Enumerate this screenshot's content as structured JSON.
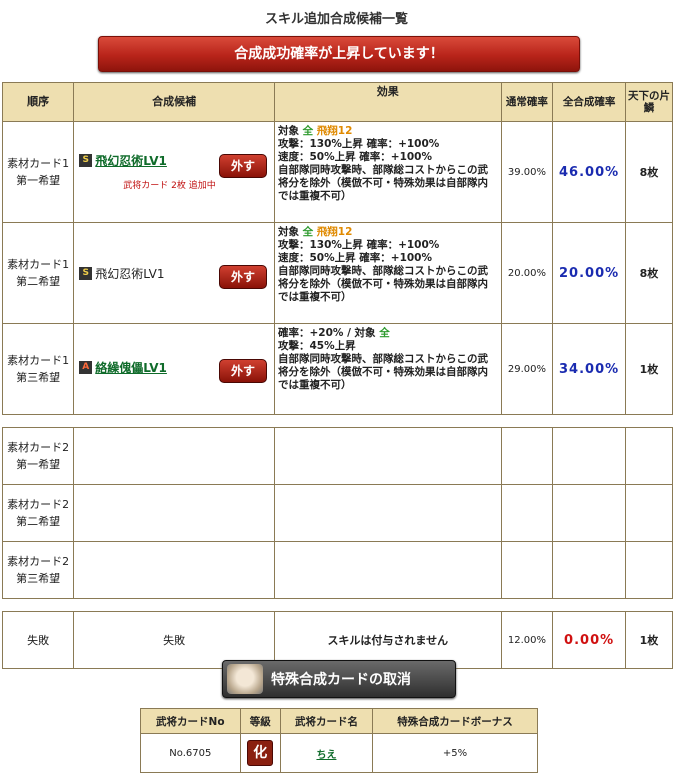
{
  "page_title": "スキル追加合成候補一覧",
  "banner": "合成成功確率が上昇しています！",
  "headers": {
    "order": "順序",
    "candidate": "合成候補",
    "effect": "効果",
    "normal_rate": "通常確率",
    "all_rate": "全合成確率",
    "tenka": "天下の片鱗"
  },
  "rows": [
    {
      "order1": "素材カード1",
      "order2": "第一希望",
      "rank": "S",
      "skill": "飛幻忍術LV1",
      "remove": "外す",
      "note": "武将カード 2枚 追加中",
      "eff_pre": "対象 ",
      "eff_target": "全",
      "eff_mid": " ",
      "eff_tag": "飛翔12",
      "eff_lines": [
        "攻撃：130%上昇  確率：+100%",
        "速度：50%上昇  確率：+100%",
        "自部隊同時攻撃時、部隊総コストからこの武将分を除外（模倣不可・特殊効果は自部隊内では重複不可）"
      ],
      "normal": "39.00%",
      "all": "46.00%",
      "tenka": "8枚"
    },
    {
      "order1": "素材カード1",
      "order2": "第二希望",
      "rank": "S",
      "skill": "飛幻忍術LV1",
      "remove": "外す",
      "eff_pre": "対象 ",
      "eff_target": "全",
      "eff_mid": " ",
      "eff_tag": "飛翔12",
      "eff_lines": [
        "攻撃：130%上昇  確率：+100%",
        "速度：50%上昇  確率：+100%",
        "自部隊同時攻撃時、部隊総コストからこの武将分を除外（模倣不可・特殊効果は自部隊内では重複不可）"
      ],
      "normal": "20.00%",
      "all": "20.00%",
      "tenka": "8枚"
    },
    {
      "order1": "素材カード1",
      "order2": "第三希望",
      "rank": "A",
      "skill": "絡繰傀儡LV1",
      "remove": "外す",
      "eff_pre": "確率：+20% / 対象 ",
      "eff_target": "全",
      "eff_mid": "",
      "eff_tag": "",
      "eff_lines": [
        "攻撃：45%上昇",
        "自部隊同時攻撃時、部隊総コストからこの武将分を除外（模倣不可・特殊効果は自部隊内では重複不可）"
      ],
      "normal": "29.00%",
      "all": "34.00%",
      "tenka": "1枚"
    }
  ],
  "empty_rows": [
    {
      "order1": "素材カード2",
      "order2": "第一希望"
    },
    {
      "order1": "素材カード2",
      "order2": "第二希望"
    },
    {
      "order1": "素材カード2",
      "order2": "第三希望"
    }
  ],
  "fail": {
    "order": "失敗",
    "candidate": "失敗",
    "effect": "スキルは付与されません",
    "normal": "12.00%",
    "all": "0.00%",
    "tenka": "1枚"
  },
  "cancel_button": "特殊合成カードの取消",
  "card_table": {
    "headers": {
      "no": "武将カードNo",
      "grade": "等級",
      "name": "武将カード名",
      "bonus": "特殊合成カードボーナス"
    },
    "no": "No.6705",
    "grade": "化",
    "name": "ちえ",
    "bonus": "+5%"
  },
  "colors": {
    "header_bg": "#eedfb0",
    "banner_red": "#b8241a",
    "link_green": "#0f6b2a",
    "all_rate_blue": "#1a2bb0",
    "fail_red": "#d01010"
  }
}
